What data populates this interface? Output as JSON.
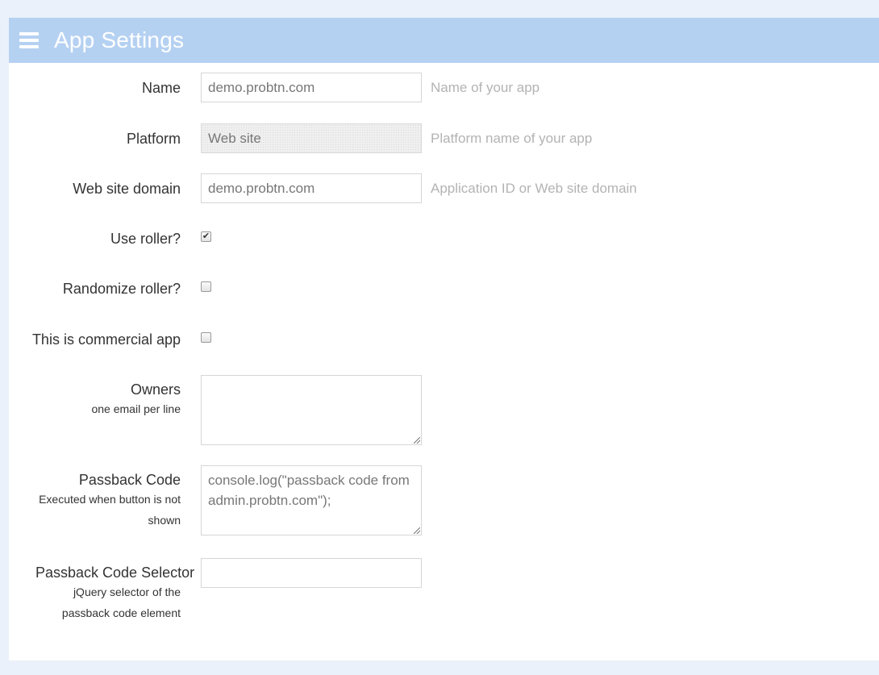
{
  "header": {
    "title": "App Settings",
    "menu_icon": "hamburger-menu-icon"
  },
  "form": {
    "name": {
      "label": "Name",
      "value": "demo.probtn.com",
      "hint": "Name of your app"
    },
    "platform": {
      "label": "Platform",
      "value": "Web site",
      "hint": "Platform name of your app"
    },
    "domain": {
      "label": "Web site domain",
      "value": "demo.probtn.com",
      "hint": "Application ID or Web site domain"
    },
    "use_roller": {
      "label": "Use roller?",
      "checked": true,
      "check_glyph": "✔"
    },
    "randomize_roller": {
      "label": "Randomize roller?",
      "checked": false
    },
    "commercial": {
      "label": "This is commercial app",
      "checked": false
    },
    "owners": {
      "label": "Owners",
      "sublabel": "one email per line",
      "value": ""
    },
    "passback_code": {
      "label": "Passback Code",
      "sublabel": "Executed when button is not shown",
      "value": "console.log(\"passback code from admin.probtn.com\");"
    },
    "passback_selector": {
      "label": "Passback Code Selector",
      "sublabel": "jQuery selector of the passback code element",
      "value": ""
    }
  },
  "colors": {
    "header_bg": "#b5d1f2",
    "page_bg": "#eaf1fa",
    "hint_text": "#b3b3b3"
  }
}
